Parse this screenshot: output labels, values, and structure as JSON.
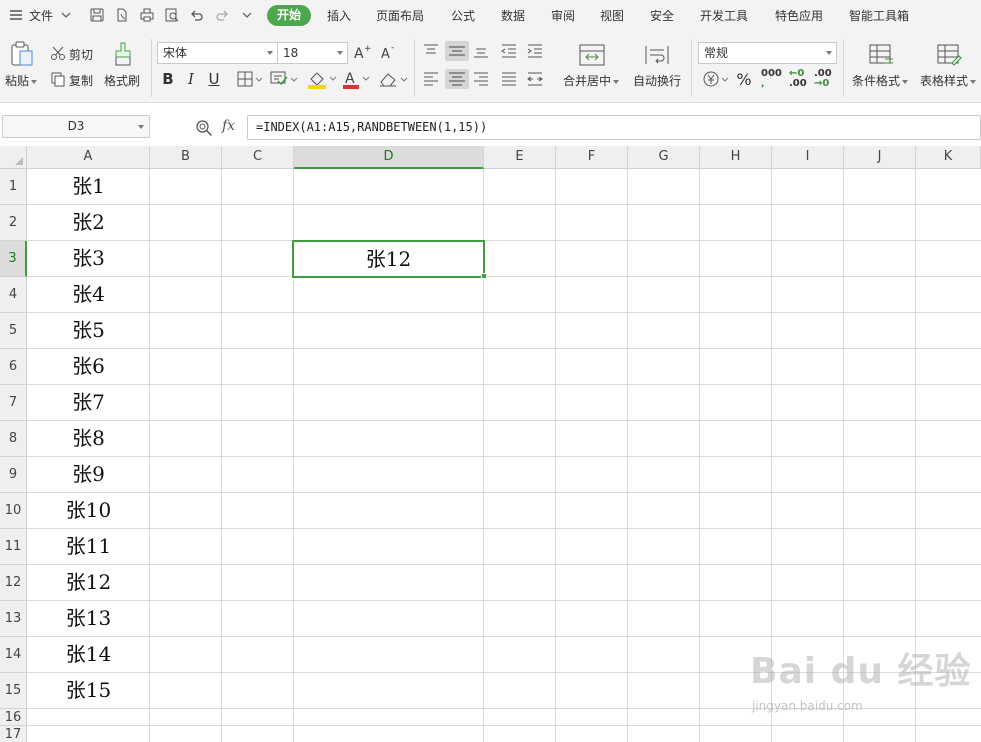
{
  "menubar": {
    "file_label": "文件",
    "tabs": [
      {
        "label": "开始",
        "active": true
      },
      {
        "label": "插入"
      },
      {
        "label": "页面布局"
      },
      {
        "label": "公式"
      },
      {
        "label": "数据"
      },
      {
        "label": "审阅"
      },
      {
        "label": "视图"
      },
      {
        "label": "安全"
      },
      {
        "label": "开发工具"
      },
      {
        "label": "特色应用"
      },
      {
        "label": "智能工具箱"
      }
    ],
    "active_tab_color": "#4ea64e"
  },
  "ribbon": {
    "paste_label": "粘贴",
    "cut_label": "剪切",
    "copy_label": "复制",
    "format_painter_label": "格式刷",
    "font_name": "宋体",
    "font_size": "18",
    "bold_label": "B",
    "italic_label": "I",
    "underline_label": "U",
    "font_color_label": "A",
    "merge_center_label": "合并居中",
    "wrap_text_label": "自动换行",
    "number_format": "常规",
    "percent_label": "%",
    "thousands_label": "000",
    "inc_decimal_label": ".00",
    "dec_decimal_label": ".00",
    "conditional_format_label": "条件格式",
    "table_style_label": "表格样式"
  },
  "formula_bar": {
    "cell_ref": "D3",
    "fx_label": "fx",
    "formula": "=INDEX(A1:A15,RANDBETWEEN(1,15))"
  },
  "sheet": {
    "columns": [
      "A",
      "B",
      "C",
      "D",
      "E",
      "F",
      "G",
      "H",
      "I",
      "J",
      "K"
    ],
    "rows": [
      "1",
      "2",
      "3",
      "4",
      "5",
      "6",
      "7",
      "8",
      "9",
      "10",
      "11",
      "12",
      "13",
      "14",
      "15",
      "16",
      "17"
    ],
    "selected_column": "D",
    "selected_row": "3",
    "column_a_values": [
      "张1",
      "张2",
      "张3",
      "张4",
      "张5",
      "张6",
      "张7",
      "张8",
      "张9",
      "张10",
      "张11",
      "张12",
      "张13",
      "张14",
      "张15"
    ],
    "active_cell_value": "张12",
    "selection_color": "#3f9c3f"
  },
  "watermark": {
    "logo_text": "Bai du 经验",
    "url": "jingyan.baidu.com"
  }
}
